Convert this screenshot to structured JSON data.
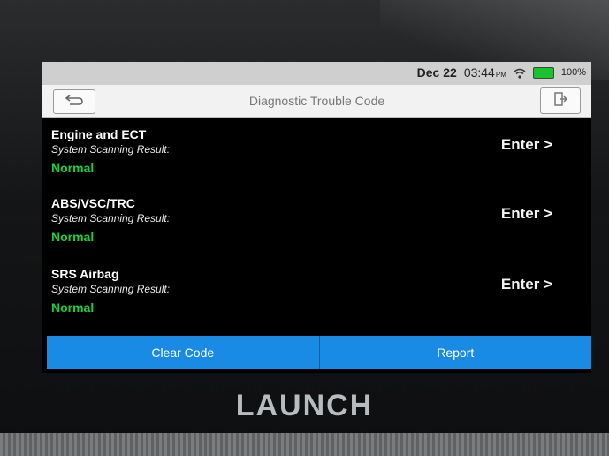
{
  "statusbar": {
    "date": "Dec 22",
    "time": "03:44",
    "ampm": "PM",
    "battery": "100%",
    "battery_color": "#17c42b"
  },
  "header": {
    "title": "Diagnostic Trouble Code",
    "back_icon": "back-arrow-icon",
    "exit_icon": "exit-icon"
  },
  "systems": [
    {
      "name": "Engine and ECT",
      "scan_label": "System Scanning Result:",
      "result": "Normal",
      "action": "Enter >"
    },
    {
      "name": "ABS/VSC/TRC",
      "scan_label": "System Scanning Result:",
      "result": "Normal",
      "action": "Enter >"
    },
    {
      "name": "SRS Airbag",
      "scan_label": "System Scanning Result:",
      "result": "Normal",
      "action": "Enter >"
    }
  ],
  "footer": {
    "clear_label": "Clear Code",
    "report_label": "Report",
    "accent": "#1a8be4"
  },
  "device": {
    "brand": "LAUNCH"
  }
}
